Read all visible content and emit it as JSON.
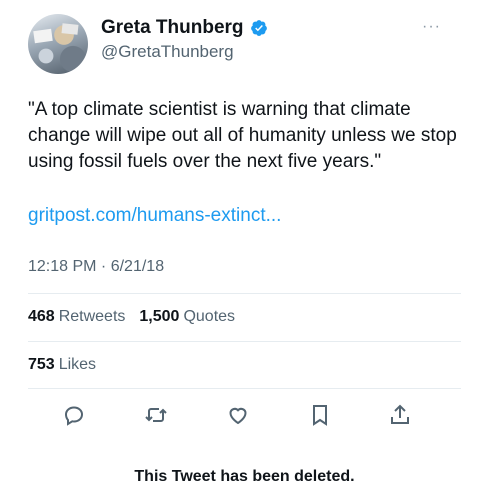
{
  "author": {
    "display_name": "Greta Thunberg",
    "handle": "@GretaThunberg",
    "verified_color": "#1d9bf0"
  },
  "tweet": {
    "text": "\"A top climate scientist is warning that climate change will wipe out all of humanity unless we stop using fossil fuels over the next five years.\"",
    "link_text": "gritpost.com/humans-extinct...",
    "timestamp": "12:18 PM · 6/21/18"
  },
  "stats": {
    "retweets_count": "468",
    "retweets_label": "Retweets",
    "quotes_count": "1,500",
    "quotes_label": "Quotes",
    "likes_count": "753",
    "likes_label": "Likes"
  },
  "actions": [
    "reply-icon",
    "retweet-icon",
    "like-icon",
    "bookmark-icon",
    "share-icon"
  ],
  "more_icon": "···",
  "notice": "This Tweet has been deleted.",
  "colors": {
    "link": "#1d9bf0",
    "secondary": "#536471",
    "text": "#0f1419"
  }
}
